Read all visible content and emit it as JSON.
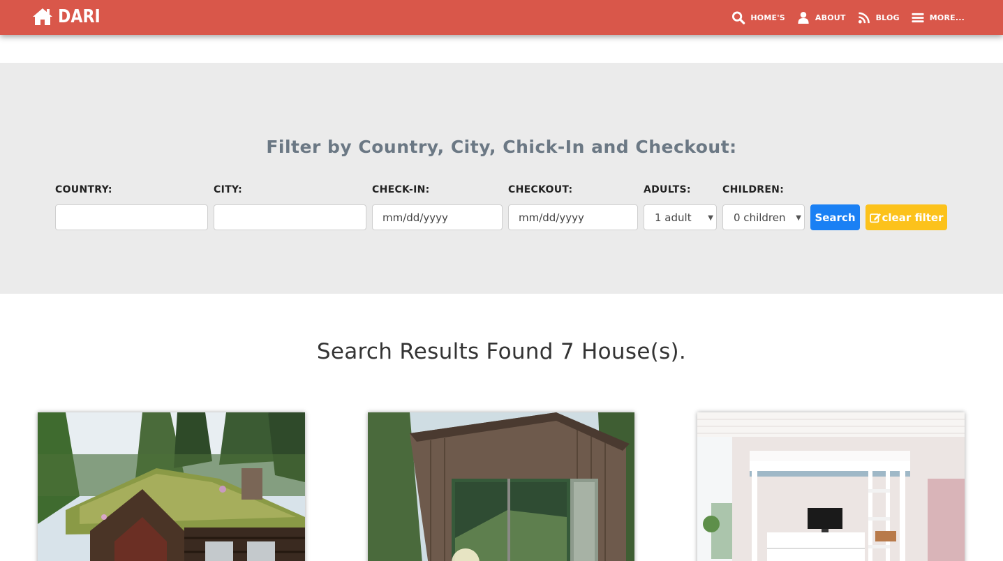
{
  "navbar": {
    "brand": "DARI",
    "items": [
      {
        "icon": "search-icon",
        "label": "HOME'S"
      },
      {
        "icon": "user-icon",
        "label": "ABOUT"
      },
      {
        "icon": "rss-icon",
        "label": "BLOG"
      },
      {
        "icon": "menu-icon",
        "label": "MORE..."
      }
    ],
    "color": "#d9574a"
  },
  "filter": {
    "title": "Filter by Country, City, Chick-In and Checkout:",
    "country_label": "COUNTRY:",
    "country_value": "",
    "city_label": "CITY:",
    "city_value": "",
    "checkin_label": "CHECK-IN:",
    "checkin_placeholder": "mm/dd/yyyy",
    "checkout_label": "CHECKOUT:",
    "checkout_placeholder": "mm/dd/yyyy",
    "adults_label": "ADULTS:",
    "adults_value": "1 adult",
    "children_label": "CHILDREN:",
    "children_value": "0 children",
    "search_button": "Search",
    "clear_button": "clear filter",
    "search_color": "#1a80f4",
    "clear_color": "#fcc21b"
  },
  "results": {
    "title": "Search Results Found 7 House(s).",
    "cards": [
      {
        "image": "grass-roof-log-cabin-photo"
      },
      {
        "image": "wooden-cabin-glass-front-photo"
      },
      {
        "image": "bedroom-loft-bed-photo"
      }
    ]
  }
}
